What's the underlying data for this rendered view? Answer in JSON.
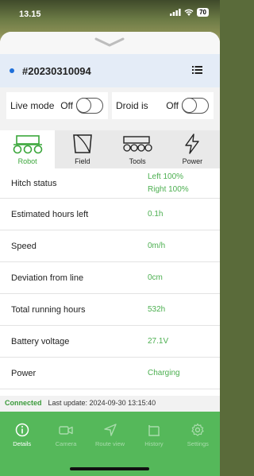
{
  "status_bar": {
    "time": "13.15",
    "battery": "70"
  },
  "header": {
    "robot_id": "#20230310094"
  },
  "toggles": [
    {
      "label": "Live mode",
      "state": "Off"
    },
    {
      "label": "Droid is",
      "state": "Off"
    }
  ],
  "tabs": [
    {
      "label": "Robot",
      "icon": "robot-icon"
    },
    {
      "label": "Field",
      "icon": "field-icon"
    },
    {
      "label": "Tools",
      "icon": "tools-icon"
    },
    {
      "label": "Power",
      "icon": "power-icon"
    }
  ],
  "details": [
    {
      "label": "Hitch status",
      "value": "Left 100%",
      "value2": "Right 100%"
    },
    {
      "label": "Estimated hours left",
      "value": "0.1h"
    },
    {
      "label": "Speed",
      "value": "0m/h"
    },
    {
      "label": "Deviation from line",
      "value": "0cm"
    },
    {
      "label": "Total running hours",
      "value": "532h"
    },
    {
      "label": "Battery voltage",
      "value": "27.1V"
    },
    {
      "label": "Power",
      "value": "Charging"
    }
  ],
  "connection": {
    "status": "Connected",
    "last_update": "Last update: 2024-09-30  13:15:40"
  },
  "nav": [
    {
      "label": "Details",
      "icon": "info-icon"
    },
    {
      "label": "Camera",
      "icon": "camera-icon"
    },
    {
      "label": "Route view",
      "icon": "navigation-icon"
    },
    {
      "label": "History",
      "icon": "history-icon"
    },
    {
      "label": "Settings",
      "icon": "gear-icon"
    }
  ],
  "colors": {
    "accent": "#4caf50",
    "nav_bg": "#55b85a",
    "header_bg": "#e4ecf7"
  }
}
